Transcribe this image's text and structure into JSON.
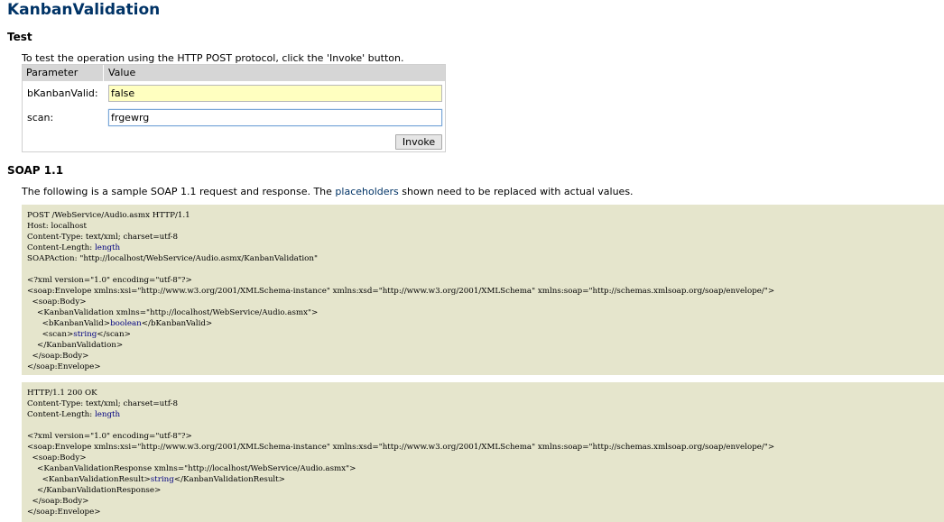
{
  "page": {
    "title": "KanbanValidation",
    "test_heading": "Test",
    "test_intro": "To test the operation using the HTTP POST protocol, click the 'Invoke' button."
  },
  "param_table": {
    "col_parameter": "Parameter",
    "col_value": "Value",
    "rows": [
      {
        "label": "bKanbanValid:",
        "value": "false"
      },
      {
        "label": "scan:",
        "value": "frgewrg"
      }
    ],
    "invoke_label": "Invoke"
  },
  "soap11": {
    "heading": "SOAP 1.1",
    "desc_pre": "The following is a sample SOAP 1.1 request and response.  The ",
    "desc_link": "placeholders",
    "desc_post": " shown need to be replaced with actual values.",
    "request_lines": [
      [
        [
          "POST /WebService/Audio.asmx HTTP/1.1",
          false
        ]
      ],
      [
        [
          "Host: localhost",
          false
        ]
      ],
      [
        [
          "Content-Type: text/xml; charset=utf-8",
          false
        ]
      ],
      [
        [
          "Content-Length: ",
          false
        ],
        [
          "length",
          true
        ]
      ],
      [
        [
          "SOAPAction: \"http://localhost/WebService/Audio.asmx/KanbanValidation\"",
          false
        ]
      ],
      [
        [
          "",
          false
        ]
      ],
      [
        [
          "<?xml version=\"1.0\" encoding=\"utf-8\"?>",
          false
        ]
      ],
      [
        [
          "<soap:Envelope xmlns:xsi=\"http://www.w3.org/2001/XMLSchema-instance\" xmlns:xsd=\"http://www.w3.org/2001/XMLSchema\" xmlns:soap=\"http://schemas.xmlsoap.org/soap/envelope/\">",
          false
        ]
      ],
      [
        [
          "  <soap:Body>",
          false
        ]
      ],
      [
        [
          "    <KanbanValidation xmlns=\"http://localhost/WebService/Audio.asmx\">",
          false
        ]
      ],
      [
        [
          "      <bKanbanValid>",
          false
        ],
        [
          "boolean",
          true
        ],
        [
          "</bKanbanValid>",
          false
        ]
      ],
      [
        [
          "      <scan>",
          false
        ],
        [
          "string",
          true
        ],
        [
          "</scan>",
          false
        ]
      ],
      [
        [
          "    </KanbanValidation>",
          false
        ]
      ],
      [
        [
          "  </soap:Body>",
          false
        ]
      ],
      [
        [
          "</soap:Envelope>",
          false
        ]
      ]
    ],
    "response_lines": [
      [
        [
          "HTTP/1.1 200 OK",
          false
        ]
      ],
      [
        [
          "Content-Type: text/xml; charset=utf-8",
          false
        ]
      ],
      [
        [
          "Content-Length: ",
          false
        ],
        [
          "length",
          true
        ]
      ],
      [
        [
          "",
          false
        ]
      ],
      [
        [
          "<?xml version=\"1.0\" encoding=\"utf-8\"?>",
          false
        ]
      ],
      [
        [
          "<soap:Envelope xmlns:xsi=\"http://www.w3.org/2001/XMLSchema-instance\" xmlns:xsd=\"http://www.w3.org/2001/XMLSchema\" xmlns:soap=\"http://schemas.xmlsoap.org/soap/envelope/\">",
          false
        ]
      ],
      [
        [
          "  <soap:Body>",
          false
        ]
      ],
      [
        [
          "    <KanbanValidationResponse xmlns=\"http://localhost/WebService/Audio.asmx\">",
          false
        ]
      ],
      [
        [
          "      <KanbanValidationResult>",
          false
        ],
        [
          "string",
          true
        ],
        [
          "</KanbanValidationResult>",
          false
        ]
      ],
      [
        [
          "    </KanbanValidationResponse>",
          false
        ]
      ],
      [
        [
          "  </soap:Body>",
          false
        ]
      ],
      [
        [
          "</soap:Envelope>",
          false
        ]
      ]
    ]
  },
  "colors": {
    "title": "#003366",
    "code_background": "#e5e5cc",
    "placeholder": "#000080",
    "filled_input": "#ffffc0"
  }
}
